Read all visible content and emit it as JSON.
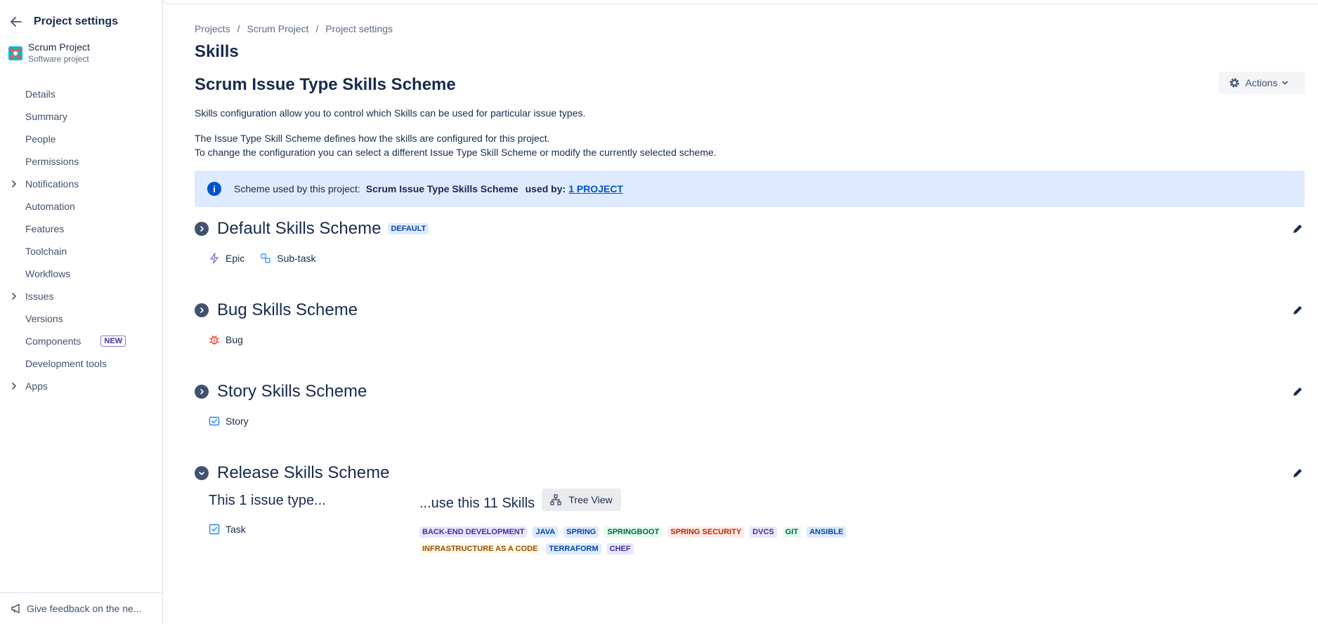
{
  "sidebar": {
    "title": "Project settings",
    "project": {
      "name": "Scrum Project",
      "type": "Software project"
    },
    "items": [
      {
        "label": "Details",
        "expandable": false
      },
      {
        "label": "Summary",
        "expandable": false
      },
      {
        "label": "People",
        "expandable": false
      },
      {
        "label": "Permissions",
        "expandable": false
      },
      {
        "label": "Notifications",
        "expandable": true
      },
      {
        "label": "Automation",
        "expandable": false
      },
      {
        "label": "Features",
        "expandable": false
      },
      {
        "label": "Toolchain",
        "expandable": false
      },
      {
        "label": "Workflows",
        "expandable": false
      },
      {
        "label": "Issues",
        "expandable": true
      },
      {
        "label": "Versions",
        "expandable": false
      },
      {
        "label": "Components",
        "expandable": false,
        "badge": "NEW"
      },
      {
        "label": "Development tools",
        "expandable": false
      },
      {
        "label": "Apps",
        "expandable": true
      }
    ],
    "feedback": "Give feedback on the ne..."
  },
  "breadcrumbs": [
    "Projects",
    "Scrum Project",
    "Project settings"
  ],
  "page_title": "Skills",
  "scheme_title": "Scrum Issue Type Skills Scheme",
  "actions_label": "Actions",
  "description": {
    "line1": "Skills configuration allow you to control which Skills can be used for particular issue types.",
    "line2": "The Issue Type Skill Scheme defines how the skills are configured for this project.",
    "line3": "To change the configuration you can select a different Issue Type Skill Scheme or modify the currently selected scheme."
  },
  "info": {
    "prefix": "Scheme used by this project:",
    "scheme": "Scrum Issue Type Skills Scheme",
    "used_by": "used by:",
    "link": "1 PROJECT"
  },
  "schemes": [
    {
      "title": "Default Skills Scheme",
      "lozenge": "DEFAULT",
      "types": [
        "Epic",
        "Sub-task"
      ]
    },
    {
      "title": "Bug Skills Scheme",
      "types": [
        "Bug"
      ]
    },
    {
      "title": "Story Skills Scheme",
      "types": [
        "Story"
      ]
    },
    {
      "title": "Release Skills Scheme",
      "types": [
        "Task"
      ]
    }
  ],
  "release": {
    "left_heading": "This 1 issue type...",
    "right_heading": "...use this 11 Skills",
    "tree_view": "Tree View",
    "task": "Task",
    "skills": [
      {
        "label": "BACK-END DEVELOPMENT",
        "bg": "#eae6ff",
        "fg": "#403294"
      },
      {
        "label": "JAVA",
        "bg": "#deebff",
        "fg": "#0747a6"
      },
      {
        "label": "SPRING",
        "bg": "#deebff",
        "fg": "#0747a6"
      },
      {
        "label": "SPRINGBOOT",
        "bg": "#e3fcef",
        "fg": "#006644"
      },
      {
        "label": "SPRING SECURITY",
        "bg": "#ffebe6",
        "fg": "#bf2600"
      },
      {
        "label": "DVCS",
        "bg": "#eae6ff",
        "fg": "#403294"
      },
      {
        "label": "GIT",
        "bg": "#e3fcef",
        "fg": "#006644"
      },
      {
        "label": "ANSIBLE",
        "bg": "#deebff",
        "fg": "#0747a6"
      },
      {
        "label": "INFRASTRUCTURE AS A CODE",
        "bg": "#fffae6",
        "fg": "#974f0c"
      },
      {
        "label": "TERRAFORM",
        "bg": "#deebff",
        "fg": "#0747a6"
      },
      {
        "label": "CHEF",
        "bg": "#eae6ff",
        "fg": "#403294"
      }
    ]
  },
  "colors": {
    "accent": "#0052cc",
    "text": "#172b4d",
    "info_bg": "#deebff"
  }
}
